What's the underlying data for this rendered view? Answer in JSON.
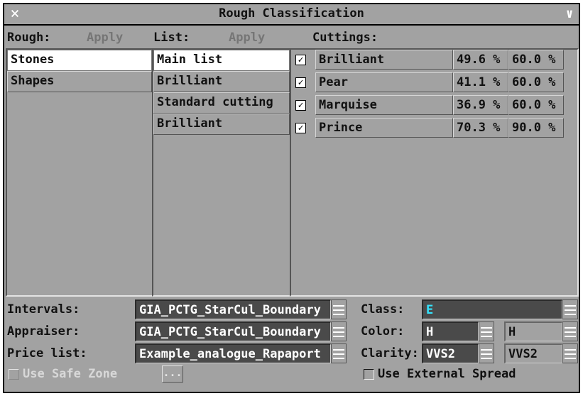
{
  "window": {
    "title": "Rough Classification",
    "close_glyph": "×",
    "dropdown_glyph": "∨"
  },
  "header": {
    "rough_label": "Rough:",
    "rough_apply": "Apply",
    "list_label": "List:",
    "list_apply": "Apply",
    "cuttings_label": "Cuttings:"
  },
  "rough_items": [
    {
      "label": "Stones",
      "selected": true
    },
    {
      "label": "Shapes",
      "selected": false
    }
  ],
  "list_items": [
    {
      "label": "Main list",
      "selected": true
    },
    {
      "label": "Brilliant",
      "selected": false
    },
    {
      "label": "Standard cutting",
      "selected": false
    },
    {
      "label": "Brilliant",
      "selected": false
    }
  ],
  "cuttings": [
    {
      "name": "Brilliant",
      "checked": true,
      "min": "49.6 %",
      "max": "60.0 %"
    },
    {
      "name": "Pear",
      "checked": true,
      "min": "41.1 %",
      "max": "60.0 %"
    },
    {
      "name": "Marquise",
      "checked": true,
      "min": "36.9 %",
      "max": "60.0 %"
    },
    {
      "name": "Prince",
      "checked": true,
      "min": "70.3 %",
      "max": "90.0 %"
    }
  ],
  "settings": {
    "intervals_label": "Intervals:",
    "intervals_value": "GIA_PCTG_StarCul_Boundary",
    "appraiser_label": "Appraiser:",
    "appraiser_value": "GIA_PCTG_StarCul_Boundary",
    "pricelist_label": "Price list:",
    "pricelist_value": "Example_analogue_Rapaport",
    "class_label": "Class:",
    "class_value": "E",
    "color_label": "Color:",
    "color_from": "H",
    "color_to": "H",
    "clarity_label": "Clarity:",
    "clarity_from": "VVS2",
    "clarity_to": "VVS2",
    "use_safe_zone": "Use Safe Zone",
    "dots_button": "...",
    "use_external_spread": "Use External Spread"
  },
  "colors": {
    "background": "#a2a2a2",
    "field_dark": "#4a4a4a",
    "class_text": "#33e5ff",
    "disabled_text": "#767676"
  }
}
